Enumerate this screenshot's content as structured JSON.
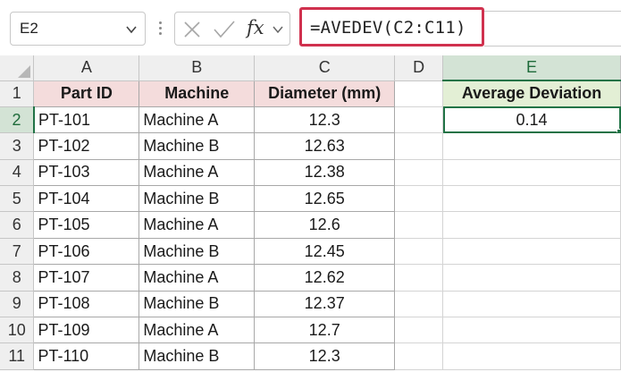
{
  "formula_bar": {
    "name_box": "E2",
    "formula": "=AVEDEV(C2:C11)",
    "fx_label": "fx"
  },
  "columns": [
    "A",
    "B",
    "C",
    "D",
    "E"
  ],
  "rows": [
    "1",
    "2",
    "3",
    "4",
    "5",
    "6",
    "7",
    "8",
    "9",
    "10",
    "11"
  ],
  "table": {
    "headers": [
      "Part ID",
      "Machine",
      "Diameter (mm)"
    ],
    "data": [
      [
        "PT-101",
        "Machine A",
        "12.3"
      ],
      [
        "PT-102",
        "Machine B",
        "12.63"
      ],
      [
        "PT-103",
        "Machine A",
        "12.38"
      ],
      [
        "PT-104",
        "Machine B",
        "12.65"
      ],
      [
        "PT-105",
        "Machine A",
        "12.6"
      ],
      [
        "PT-106",
        "Machine B",
        "12.45"
      ],
      [
        "PT-107",
        "Machine A",
        "12.62"
      ],
      [
        "PT-108",
        "Machine B",
        "12.37"
      ],
      [
        "PT-109",
        "Machine A",
        "12.7"
      ],
      [
        "PT-110",
        "Machine B",
        "12.3"
      ]
    ]
  },
  "result": {
    "header": "Average Deviation",
    "value": "0.14"
  },
  "colors": {
    "accent": "#217346",
    "formula_highlight": "#d0314e",
    "table_header_fill": "#f4dcdc",
    "result_header_fill": "#e3efd5"
  }
}
